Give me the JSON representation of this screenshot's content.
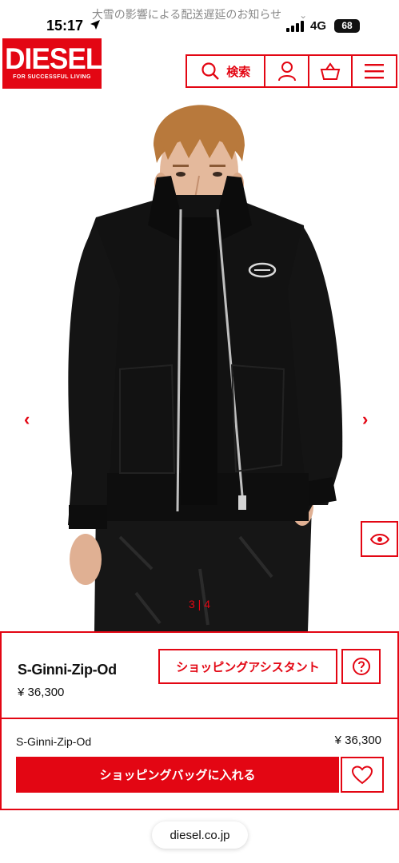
{
  "status_bar": {
    "time": "15:17",
    "network": "4G",
    "battery": "68",
    "notice": "大雪の影響による配送遅延のお知らせ"
  },
  "header": {
    "logo_text": "DIESEL",
    "logo_tagline": "FOR SUCCESSFUL LIVING",
    "search_label": "検索",
    "icons": [
      "search-icon",
      "account-icon",
      "basket-icon",
      "menu-icon"
    ]
  },
  "gallery": {
    "counter": "3 | 4",
    "icons": [
      "chevron-left-icon",
      "chevron-right-icon",
      "eye-icon"
    ]
  },
  "product": {
    "name": "S-Ginni-Zip-Od",
    "price": "¥ 36,300",
    "assistant_button": "ショッピングアシスタント",
    "help_icon": "question-icon"
  },
  "sticky_bar": {
    "name": "S-Ginni-Zip-Od",
    "price": "¥ 36,300",
    "add_to_bag": "ショッピングバッグに入れる",
    "wishlist_icon": "heart-icon"
  },
  "browser": {
    "url": "diesel.co.jp"
  },
  "colors": {
    "brand_red": "#e30613",
    "jacket": "#121212",
    "skin": "#e4b99c",
    "hair": "#b8793c"
  }
}
